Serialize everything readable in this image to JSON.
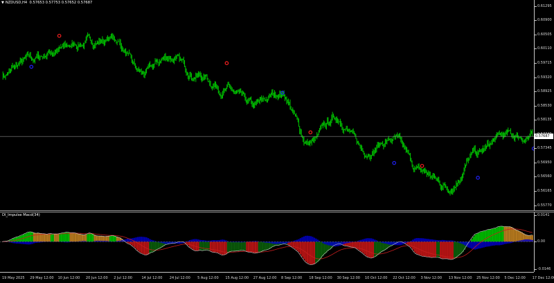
{
  "chart_header": {
    "symbol_timeframe": "NZDUSD,H4",
    "ohlc": "0.57653 0.57753 0.57652 0.57687"
  },
  "colors": {
    "background": "#000000",
    "candles": "#00c800",
    "signal_up": "#1e1ee6",
    "signal_down": "#e61e1e",
    "impulse_up": "#00b400",
    "impulse_flat": "#b4781e",
    "impulse_down": "#b41414",
    "impulse_dark": "#0a5a0a",
    "impulse_blue": "#0000c8",
    "signal_line": "#c81e1e"
  },
  "price_scale": {
    "current_price": "0.57687",
    "ticks": [
      "0.61295",
      "0.60900",
      "0.60505",
      "0.60110",
      "0.59715",
      "0.59320",
      "0.58925",
      "0.58530",
      "0.58135",
      "0.57740",
      "0.57345",
      "0.56950",
      "0.56560",
      "0.56165",
      "0.55770"
    ]
  },
  "indicator": {
    "title": "DI_Impulse Macd(34)",
    "ticks": [
      "0.0141",
      "0.00",
      "-0.0146"
    ]
  },
  "time_axis": {
    "labels": [
      "19 May 2025",
      "29 May 12:00",
      "10 Jun 12:00",
      "20 Jun 12:00",
      "2 Jul 12:00",
      "14 Jul 12:00",
      "24 Jul 12:00",
      "5 Aug 12:00",
      "15 Aug 12:00",
      "27 Aug 12:00",
      "8 Sep 12:00",
      "18 Sep 12:00",
      "30 Sep 12:00",
      "10 Oct 12:00",
      "22 Oct 12:00",
      "3 Nov 12:00",
      "13 Nov 12:00",
      "25 Nov 12:00",
      "5 Dec 12:00",
      "17 Dec 12:00"
    ]
  },
  "chart_data": {
    "type": "line",
    "title": "NZDUSD,H4",
    "series": [
      {
        "name": "NZDUSD",
        "x": [
          "19 May 2025",
          "29 May 12:00",
          "10 Jun 12:00",
          "20 Jun 12:00",
          "2 Jul 12:00",
          "14 Jul 12:00",
          "24 Jul 12:00",
          "5 Aug 12:00",
          "15 Aug 12:00",
          "27 Aug 12:00",
          "8 Sep 12:00",
          "18 Sep 12:00",
          "30 Sep 12:00",
          "10 Oct 12:00",
          "22 Oct 12:00",
          "3 Nov 12:00",
          "13 Nov 12:00",
          "25 Nov 12:00",
          "5 Dec 12:00",
          "17 Dec 12:00"
        ],
        "values": [
          0.594,
          0.598,
          0.601,
          0.603,
          0.604,
          0.594,
          0.599,
          0.594,
          0.59,
          0.585,
          0.589,
          0.575,
          0.582,
          0.573,
          0.576,
          0.567,
          0.563,
          0.572,
          0.577,
          0.5769
        ]
      }
    ],
    "ylim": [
      0.5577,
      0.613
    ],
    "signals": [
      {
        "x": "29 May 12:00",
        "value": 0.5962,
        "dir": "up"
      },
      {
        "x": "10 Jun 12:00",
        "value": 0.6048,
        "dir": "down"
      },
      {
        "x": "15 Aug 12:00",
        "value": 0.5972,
        "dir": "down"
      },
      {
        "x": "8 Sep 12:00",
        "value": 0.589,
        "dir": "up"
      },
      {
        "x": "18 Sep 12:00",
        "value": 0.578,
        "dir": "down"
      },
      {
        "x": "22 Oct 12:00",
        "value": 0.5695,
        "dir": "up"
      },
      {
        "x": "3 Nov 12:00",
        "value": 0.5687,
        "dir": "down"
      },
      {
        "x": "25 Nov 12:00",
        "value": 0.5654,
        "dir": "up"
      },
      {
        "x": "17 Dec 12:00",
        "value": 0.5735,
        "dir": "up"
      }
    ],
    "indicator_ylim": [
      -0.0146,
      0.0141
    ]
  }
}
